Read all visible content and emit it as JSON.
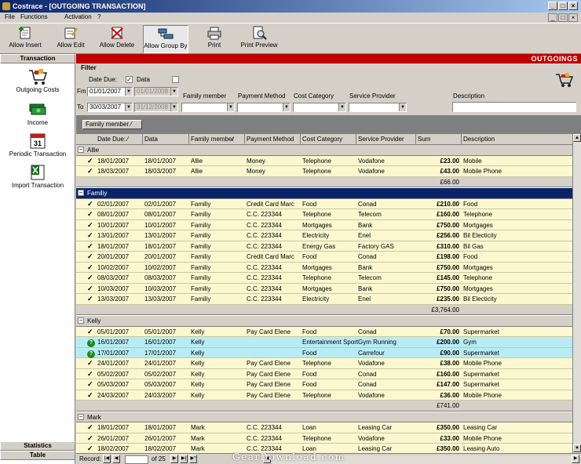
{
  "window": {
    "title": "Costrace - [OUTGOING TRANSACTION]"
  },
  "menu": [
    "File",
    "Functions",
    "Activation",
    "?"
  ],
  "toolbar": [
    {
      "label": "Allow Insert",
      "icon": "insert-icon"
    },
    {
      "label": "Allow Edit",
      "icon": "edit-icon"
    },
    {
      "label": "Allow Delete",
      "icon": "delete-icon"
    },
    {
      "label": "Allow Group By",
      "icon": "group-by-icon",
      "pressed": true
    },
    {
      "label": "Print",
      "icon": "printer-icon"
    },
    {
      "label": "Print Preview",
      "icon": "print-preview-icon"
    }
  ],
  "sidebar": {
    "header": "Transaction",
    "items": [
      {
        "label": "Outgoing Costs",
        "icon": "shopping-cart-icon"
      },
      {
        "label": "Income",
        "icon": "money-icon"
      },
      {
        "label": "Periodic Transaction",
        "icon": "calendar-icon"
      },
      {
        "label": "Import Transaction",
        "icon": "excel-icon"
      }
    ],
    "footer": [
      "Statistics",
      "Table"
    ]
  },
  "banner": "OUTGOINGS",
  "filter": {
    "title": "Filter",
    "date_due_label": "Date Due:",
    "data_label": "Data",
    "fm_label": "Fm",
    "to_label": "To",
    "date_due_from": "01/01/2007",
    "data_from": "01/01/2008",
    "date_due_to": "30/03/2007",
    "data_to": "31/12/2008",
    "family_member_label": "Family member",
    "payment_method_label": "Payment Method",
    "cost_category_label": "Cost Category",
    "service_provider_label": "Service Provider",
    "description_label": "Description"
  },
  "group_chip": "Family member",
  "columns": [
    "Date Due:",
    "Data",
    "Family member",
    "Payment Method",
    "Cost Category",
    "Service Provider",
    "Sum",
    "Description"
  ],
  "groups": [
    {
      "name": "Allie",
      "rows": [
        [
          "18/01/2007",
          "18/01/2007",
          "Allie",
          "Money",
          "Telephone",
          "Vodafone",
          "£23.00",
          "Mobile",
          "check"
        ],
        [
          "18/03/2007",
          "18/03/2007",
          "Allie",
          "Money",
          "Telephone",
          "Vodafone",
          "£43.00",
          "Mobile Phone",
          "check"
        ]
      ],
      "total": "£66.00"
    },
    {
      "name": "Familiy",
      "selected": true,
      "rows": [
        [
          "02/01/2007",
          "02/01/2007",
          "Familiy",
          "Credit Card Marc",
          "Food",
          "Conad",
          "£210.00",
          "Food",
          "check"
        ],
        [
          "08/01/2007",
          "08/01/2007",
          "Familiy",
          "C.C. 223344",
          "Telephone",
          "Telecom",
          "£160.00",
          "Telephone",
          "check"
        ],
        [
          "10/01/2007",
          "10/01/2007",
          "Familiy",
          "C.C. 223344",
          "Mortgages",
          "Bank",
          "£750.00",
          "Mortgages",
          "check"
        ],
        [
          "13/01/2007",
          "13/01/2007",
          "Familiy",
          "C.C. 223344",
          "Electricity",
          "Enel",
          "£256.00",
          "Bil Electicity",
          "check"
        ],
        [
          "18/01/2007",
          "18/01/2007",
          "Familiy",
          "C.C. 223344",
          "Energy Gas",
          "Factory GAS",
          "£310.00",
          "Bil Gas",
          "check"
        ],
        [
          "20/01/2007",
          "20/01/2007",
          "Familiy",
          "Credit Card Marc",
          "Food",
          "Conad",
          "£198.00",
          "Food",
          "check"
        ],
        [
          "10/02/2007",
          "10/02/2007",
          "Familiy",
          "C.C. 223344",
          "Mortgages",
          "Bank",
          "£750.00",
          "Mortgages",
          "check"
        ],
        [
          "08/03/2007",
          "08/03/2007",
          "Familiy",
          "C.C. 223344",
          "Telephone",
          "Telecom",
          "£145.00",
          "Telephone",
          "check"
        ],
        [
          "10/03/2007",
          "10/03/2007",
          "Familiy",
          "C.C. 223344",
          "Mortgages",
          "Bank",
          "£750.00",
          "Mortgages",
          "check"
        ],
        [
          "13/03/2007",
          "13/03/2007",
          "Familiy",
          "C.C. 223344",
          "Electricity",
          "Enel",
          "£235.00",
          "Bil Electicity",
          "check"
        ]
      ],
      "total": "£3,764.00"
    },
    {
      "name": "Kelly",
      "rows": [
        [
          "05/01/2007",
          "05/01/2007",
          "Kelly",
          "Pay Card Elene",
          "Food",
          "Conad",
          "£70.00",
          "Supermarket",
          "check"
        ],
        [
          "16/01/2007",
          "16/01/2007",
          "Kelly",
          "",
          "Entertainment Sport",
          "Gym Running",
          "£200.00",
          "Gym",
          "question"
        ],
        [
          "17/01/2007",
          "17/01/2007",
          "Kelly",
          "",
          "Food",
          "Carrefour",
          "£90.00",
          "Supermarket",
          "question"
        ],
        [
          "24/01/2007",
          "24/01/2007",
          "Kelly",
          "Pay Card Elene",
          "Telephone",
          "Vodafone",
          "£38.00",
          "Mobile Phone",
          "check"
        ],
        [
          "05/02/2007",
          "05/02/2007",
          "Kelly",
          "Pay Card Elene",
          "Food",
          "Conad",
          "£160.00",
          "Supermarket",
          "check"
        ],
        [
          "05/03/2007",
          "05/03/2007",
          "Kelly",
          "Pay Card Elene",
          "Food",
          "Conad",
          "£147.00",
          "Supermarket",
          "check"
        ],
        [
          "24/03/2007",
          "24/03/2007",
          "Kelly",
          "Pay Card Elene",
          "Telephone",
          "Vodafone",
          "£36.00",
          "Mobile Phone",
          "check"
        ]
      ],
      "total": "£741.00"
    },
    {
      "name": "Mark",
      "rows": [
        [
          "18/01/2007",
          "18/01/2007",
          "Mark",
          "C.C. 223344",
          "Loan",
          "Leasing Car",
          "£350.00",
          "Leasing Car",
          "check"
        ],
        [
          "26/01/2007",
          "26/01/2007",
          "Mark",
          "C.C. 223344",
          "Telephone",
          "Vodafone",
          "£33.00",
          "Mobile Phone",
          "check"
        ],
        [
          "18/02/2007",
          "18/02/2007",
          "Mark",
          "C.C. 223344",
          "Loan",
          "Leasing Car",
          "£350.00",
          "Leasing Auto",
          "check"
        ]
      ]
    }
  ],
  "nav": {
    "record_label": "Record:",
    "of_label": "of 25"
  },
  "watermark": "GearDownload.com",
  "colors": {
    "title": "#0a246a",
    "banner": "#c00000",
    "row": "#fbf8d0",
    "row_pending": "#b8ecf4",
    "group_selected": "#0a246a"
  }
}
